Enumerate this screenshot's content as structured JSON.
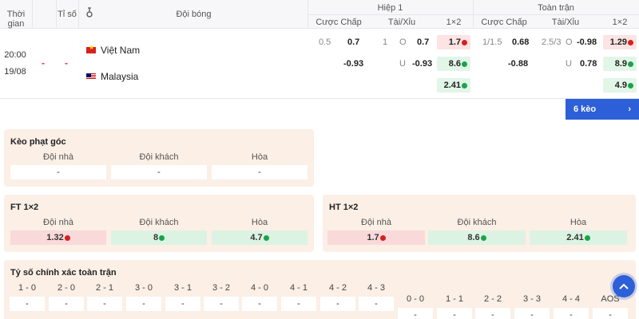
{
  "header": {
    "time": "Thời gian",
    "score": "Tỉ số",
    "teams": "Đội bóng",
    "half1": "Hiệp 1",
    "fulltime": "Toàn trận",
    "handicap": "Cược Chấp",
    "overunder": "Tài/Xỉu",
    "onextwo": "1×2"
  },
  "match": {
    "time": "20:00",
    "date": "19/08",
    "score_home": "-",
    "score_away": "-",
    "home_team": "Việt Nam",
    "away_team": "Malaysia",
    "h1": {
      "hdp_line": "0.5",
      "hdp_home": "0.7",
      "hdp_away": "-0.93",
      "ou_line": "1",
      "ou_over_label": "O",
      "ou_over": "0.7",
      "ou_under_label": "U",
      "ou_under": "-0.93",
      "x1": "1.7",
      "x2": "8.6",
      "xdraw": "2.41"
    },
    "ft": {
      "hdp_line": "1/1.5",
      "hdp_home": "0.68",
      "hdp_away": "-0.88",
      "ou_line": "2.5/3",
      "ou_over_label": "O",
      "ou_over": "-0.98",
      "ou_under_label": "U",
      "ou_under": "0.78",
      "x1": "1.29",
      "x2": "8.9",
      "xdraw": "4.9"
    }
  },
  "more_button": {
    "label": "6 kèo",
    "chevron": "›"
  },
  "corner": {
    "title": "Kèo phạt góc",
    "cols": [
      "Đội nhà",
      "Đội khách",
      "Hòa"
    ],
    "vals": [
      "-",
      "-",
      "-"
    ]
  },
  "ft1x2": {
    "title": "FT 1×2",
    "cols": [
      "Đội nhà",
      "Đội khách",
      "Hòa"
    ],
    "vals": [
      "1.32",
      "8",
      "4.7"
    ]
  },
  "ht1x2": {
    "title": "HT 1×2",
    "cols": [
      "Đội nhà",
      "Đội khách",
      "Hòa"
    ],
    "vals": [
      "1.7",
      "8.6",
      "2.41"
    ]
  },
  "exact_score": {
    "title": "Tỷ số chính xác toàn trận",
    "row1": [
      "1 - 0",
      "2 - 0",
      "2 - 1",
      "3 - 0",
      "3 - 1",
      "3 - 2",
      "4 - 0",
      "4 - 1",
      "4 - 2",
      "4 - 3"
    ],
    "row1_vals": [
      "-",
      "-",
      "-",
      "-",
      "-",
      "-",
      "-",
      "-",
      "-",
      "-"
    ],
    "row2": [
      "0 - 0",
      "1 - 1",
      "2 - 2",
      "3 - 3",
      "4 - 4",
      "AOS"
    ],
    "row2_vals": [
      "-",
      "-",
      "-",
      "-",
      "-",
      "-"
    ]
  },
  "colors": {
    "accent": "#2d5fd8",
    "down": "#d6201f",
    "up": "#1aa34a",
    "card_bg": "#fbefe6"
  },
  "icons": {
    "scroll_top": "chevron-up-icon",
    "stadium": "whistle-icon"
  }
}
